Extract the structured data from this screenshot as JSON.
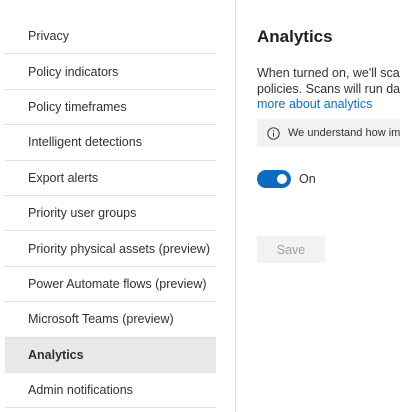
{
  "sidebar": {
    "items": [
      {
        "label": "Privacy",
        "active": false
      },
      {
        "label": "Policy indicators",
        "active": false
      },
      {
        "label": "Policy timeframes",
        "active": false
      },
      {
        "label": "Intelligent detections",
        "active": false
      },
      {
        "label": "Export alerts",
        "active": false
      },
      {
        "label": "Priority user groups",
        "active": false
      },
      {
        "label": "Priority physical assets (preview)",
        "active": false
      },
      {
        "label": "Power Automate flows (preview)",
        "active": false
      },
      {
        "label": "Microsoft Teams (preview)",
        "active": false
      },
      {
        "label": "Analytics",
        "active": true
      },
      {
        "label": "Admin notifications",
        "active": false
      }
    ]
  },
  "main": {
    "title": "Analytics",
    "description_line1": "When turned on, we'll scan",
    "description_line2": "policies. Scans will run daily",
    "learn_more_link": "more about analytics",
    "info_bar_text": "We understand how impo",
    "toggle": {
      "state": "On",
      "checked": true
    },
    "save_label": "Save"
  },
  "colors": {
    "accent": "#0f6cbd",
    "active_item_bg": "#e8e8e8",
    "info_bar_bg": "#f3f2f1",
    "disabled_text": "#a19f9d"
  },
  "icons": {
    "info": "info-circle-icon"
  }
}
